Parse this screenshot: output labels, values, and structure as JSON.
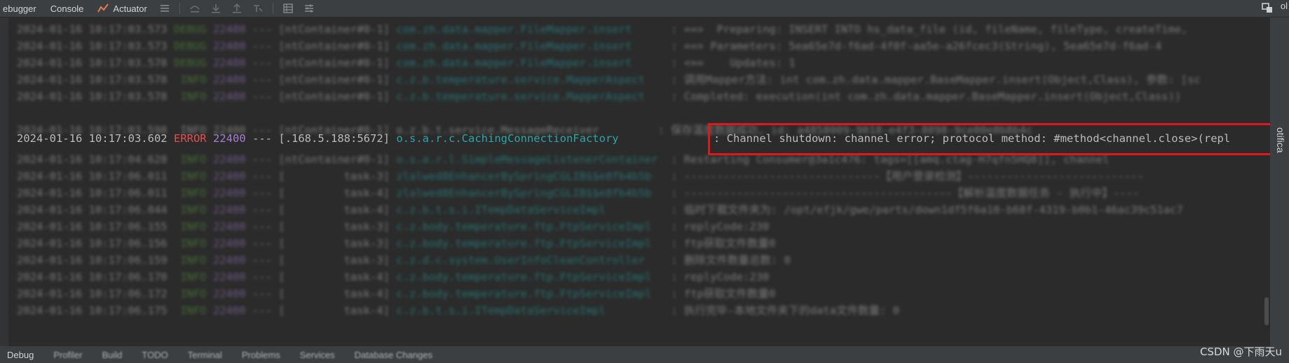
{
  "toolbar": {
    "tabs": [
      "ebugger",
      "Console",
      "Actuator"
    ],
    "right_text": "ol"
  },
  "highlighted_line": {
    "timestamp": "2024-01-16 10:17:03.602",
    "level": "ERROR",
    "pid": "22400",
    "sep": "---",
    "thread": "[.168.5.188:5672]",
    "logger": "o.s.a.r.c.CachingConnectionFactory",
    "message": ": Channel shutdown: channel error; protocol method: #method<channel.close>(repl"
  },
  "partial_line": {
    "text": "2024-01-16 10:17:03.598  INFO 22400 --- [ntContainer#0-1] o.z.b.t.service.MessageReceiver         : 保存温度数据成功, id: a4858009-9018-e4f3-8098-9ce00e0b8b4c"
  },
  "blurred_lines": [
    {
      "ts": "2024-01-16 10:17:03.573",
      "level": "DEBUG",
      "pid": "22400",
      "thread": "[ntContainer#0-1]",
      "logger": "com.zh.data.mapper.FileMapper.insert",
      "msg": ": ==>  Preparing: INSERT INTO hs_data_file (id, fileName, fileType, createTime,"
    },
    {
      "ts": "2024-01-16 10:17:03.573",
      "level": "DEBUG",
      "pid": "22400",
      "thread": "[ntContainer#0-1]",
      "logger": "com.zh.data.mapper.FileMapper.insert",
      "msg": ": ==> Parameters: 5ea65e7d-f6ad-4f0f-aa5e-a26fcec3(String), 5ea65e7d-f6ad-4"
    },
    {
      "ts": "2024-01-16 10:17:03.578",
      "level": "DEBUG",
      "pid": "22400",
      "thread": "[ntContainer#0-1]",
      "logger": "com.zh.data.mapper.FileMapper.insert",
      "msg": ": <==    Updates: 1"
    },
    {
      "ts": "2024-01-16 10:17:03.578",
      "level": "INFO",
      "pid": "22400",
      "thread": "[ntContainer#0-1]",
      "logger": "c.z.b.temperature.service.MapperAspect",
      "msg": ": 调用Mapper方法: int com.zh.data.mapper.BaseMapper.insert(Object,Class), 参数: [sc"
    },
    {
      "ts": "2024-01-16 10:17:03.578",
      "level": "INFO",
      "pid": "22400",
      "thread": "[ntContainer#0-1]",
      "logger": "c.z.b.temperature.service.MapperAspect",
      "msg": ": Completed: execution(int com.zh.data.mapper.BaseMapper.insert(Object,Class))"
    },
    {
      "ts": "2024-01-16 10:17:04.628",
      "level": "INFO",
      "pid": "22400",
      "thread": "[ntContainer#0-1]",
      "logger": "o.s.a.r.l.SimpleMessageListenerContainer",
      "msg": ": Restarting Consumer@3a1c476: tags=[[amq.ctag-H7qfn5HQ8]], channel"
    },
    {
      "ts": "2024-01-16 10:17:06.011",
      "level": "INFO",
      "pid": "22400",
      "thread": "[         task-3]",
      "logger": "zlalwed8EnhancerBySpringCGLIB$$e8fb4b5b",
      "msg": ": ------------------------------【用户登录检测】---------------------------"
    },
    {
      "ts": "2024-01-16 10:17:06.011",
      "level": "INFO",
      "pid": "22400",
      "thread": "[         task-4]",
      "logger": "zlalwed8EnhancerBySpringCGLIB$$e8fb4b5b",
      "msg": ": -----------------------------------------【解析温度数据任务 - 执行中】----"
    },
    {
      "ts": "2024-01-16 10:17:06.044",
      "level": "INFO",
      "pid": "22400",
      "thread": "[         task-4]",
      "logger": "c.z.b.t.s.i.ITempDataServiceImpl",
      "msg": ": 临时下载文件夹为: /opt/efjk/gwe/parts/down1df5f6a10-b68f-4319-b0b1-46ac39c51ac7"
    },
    {
      "ts": "2024-01-16 10:17:06.155",
      "level": "INFO",
      "pid": "22400",
      "thread": "[         task-3]",
      "logger": "c.z.body.temperature.ftp.FtpServiceImpl",
      "msg": ": replyCode:230"
    },
    {
      "ts": "2024-01-16 10:17:06.156",
      "level": "INFO",
      "pid": "22400",
      "thread": "[         task-3]",
      "logger": "c.z.body.temperature.ftp.FtpServiceImpl",
      "msg": ": ftp获取文件数量0"
    },
    {
      "ts": "2024-01-16 10:17:06.159",
      "level": "INFO",
      "pid": "22400",
      "thread": "[         task-3]",
      "logger": "c.z.d.c.system.UserInfoCleanController",
      "msg": ": 删除文件数量总数: 0"
    },
    {
      "ts": "2024-01-16 10:17:06.170",
      "level": "INFO",
      "pid": "22400",
      "thread": "[         task-4]",
      "logger": "c.z.body.temperature.ftp.FtpServiceImpl",
      "msg": ": replyCode:230"
    },
    {
      "ts": "2024-01-16 10:17:06.172",
      "level": "INFO",
      "pid": "22400",
      "thread": "[         task-4]",
      "logger": "c.z.body.temperature.ftp.FtpServiceImpl",
      "msg": ": ftp获取文件数量0"
    },
    {
      "ts": "2024-01-16 10:17:06.175",
      "level": "INFO",
      "pid": "22400",
      "thread": "[         task-4]",
      "logger": "c.z.b.t.s.i.ITempDataServiceImpl",
      "msg": ": 执行完毕-本地文件夹下的data文件数量: 0"
    }
  ],
  "right_panel": {
    "text": "otifica"
  },
  "bottom_tabs": [
    "Debug",
    "Profiler",
    "Build",
    "TODO",
    "Terminal",
    "Problems",
    "Services",
    "Database Changes"
  ],
  "watermark": "CSDN @下雨天u"
}
